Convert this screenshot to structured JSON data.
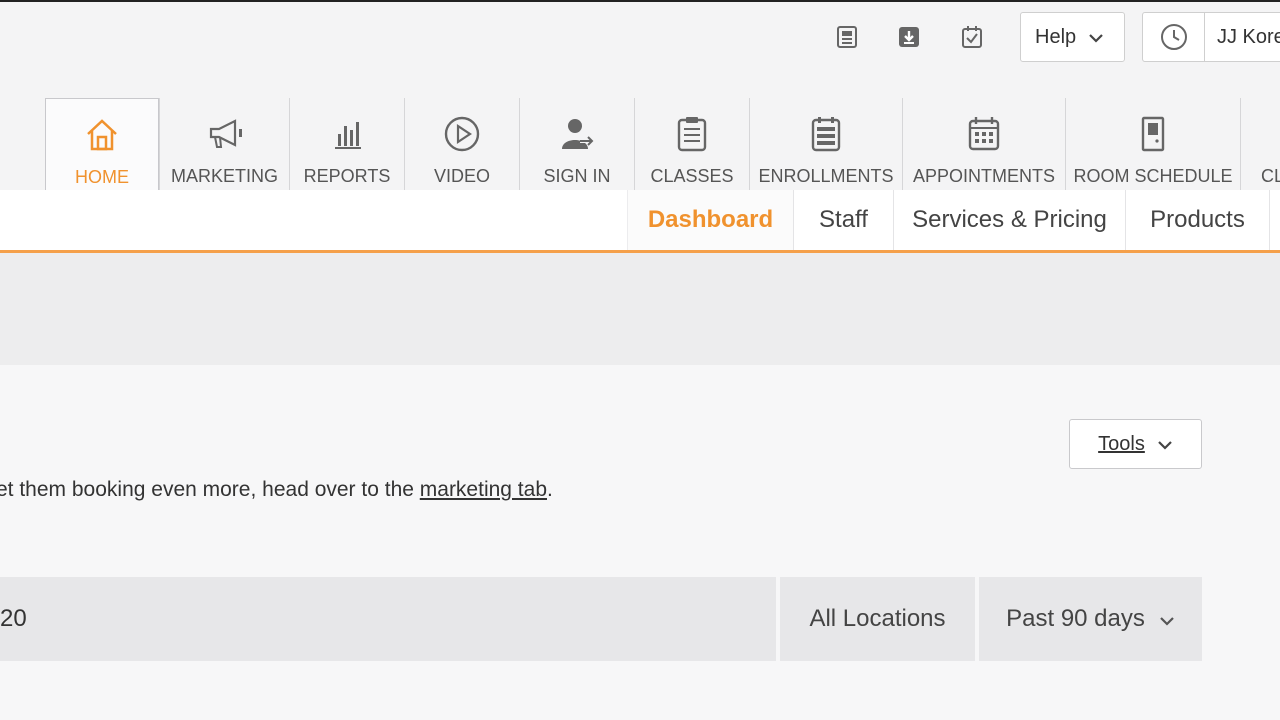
{
  "header": {
    "icons": [
      "news-icon",
      "download-icon",
      "checklist-icon"
    ],
    "help_label": "Help",
    "user_name": "JJ Kore"
  },
  "nav": {
    "tabs": [
      {
        "label": "HOME",
        "icon": "home-icon",
        "active": true
      },
      {
        "label": "MARKETING",
        "icon": "megaphone-icon",
        "active": false
      },
      {
        "label": "REPORTS",
        "icon": "bar-chart-icon",
        "active": false
      },
      {
        "label": "VIDEO",
        "icon": "play-icon",
        "active": false
      },
      {
        "label": "SIGN IN",
        "icon": "user-signin-icon",
        "active": false
      },
      {
        "label": "CLASSES",
        "icon": "list-icon",
        "active": false
      },
      {
        "label": "ENROLLMENTS",
        "icon": "enrollment-icon",
        "active": false
      },
      {
        "label": "APPOINTMENTS",
        "icon": "calendar-icon",
        "active": false
      },
      {
        "label": "ROOM SCHEDULE",
        "icon": "door-icon",
        "active": false
      },
      {
        "label": "CL",
        "icon": "clients-icon",
        "active": false
      }
    ],
    "accent_color": "#f0922e"
  },
  "subnav": {
    "tabs": [
      {
        "label": "Dashboard",
        "active": true
      },
      {
        "label": "Staff",
        "active": false
      },
      {
        "label": "Services & Pricing",
        "active": false
      },
      {
        "label": "Products",
        "active": false
      }
    ]
  },
  "main": {
    "tools_label": "Tools",
    "info_prefix": "et them booking even more, head over to the ",
    "info_link": "marketing tab",
    "info_suffix": "."
  },
  "filters": {
    "main_text": "20",
    "location": "All Locations",
    "range": "Past 90 days"
  }
}
